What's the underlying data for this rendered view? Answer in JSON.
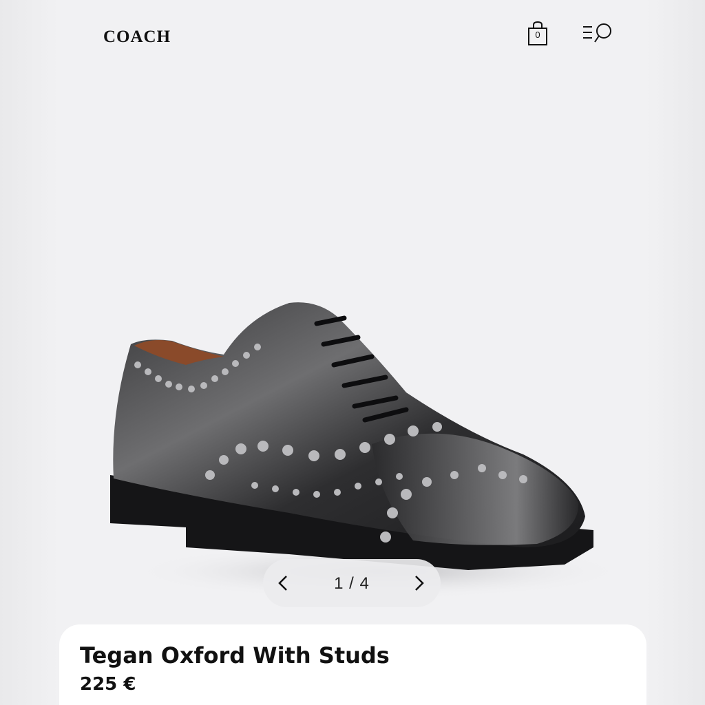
{
  "header": {
    "brand": "COACH",
    "bag_count": "0",
    "icons": [
      "shopping-bag-icon",
      "menu-search-icon"
    ]
  },
  "gallery": {
    "current": 1,
    "total": 4,
    "counter_text": "1 / 4",
    "prev_icon": "chevron-left-icon",
    "next_icon": "chevron-right-icon"
  },
  "product": {
    "name": "Tegan Oxford With Studs",
    "price": "225 €"
  }
}
